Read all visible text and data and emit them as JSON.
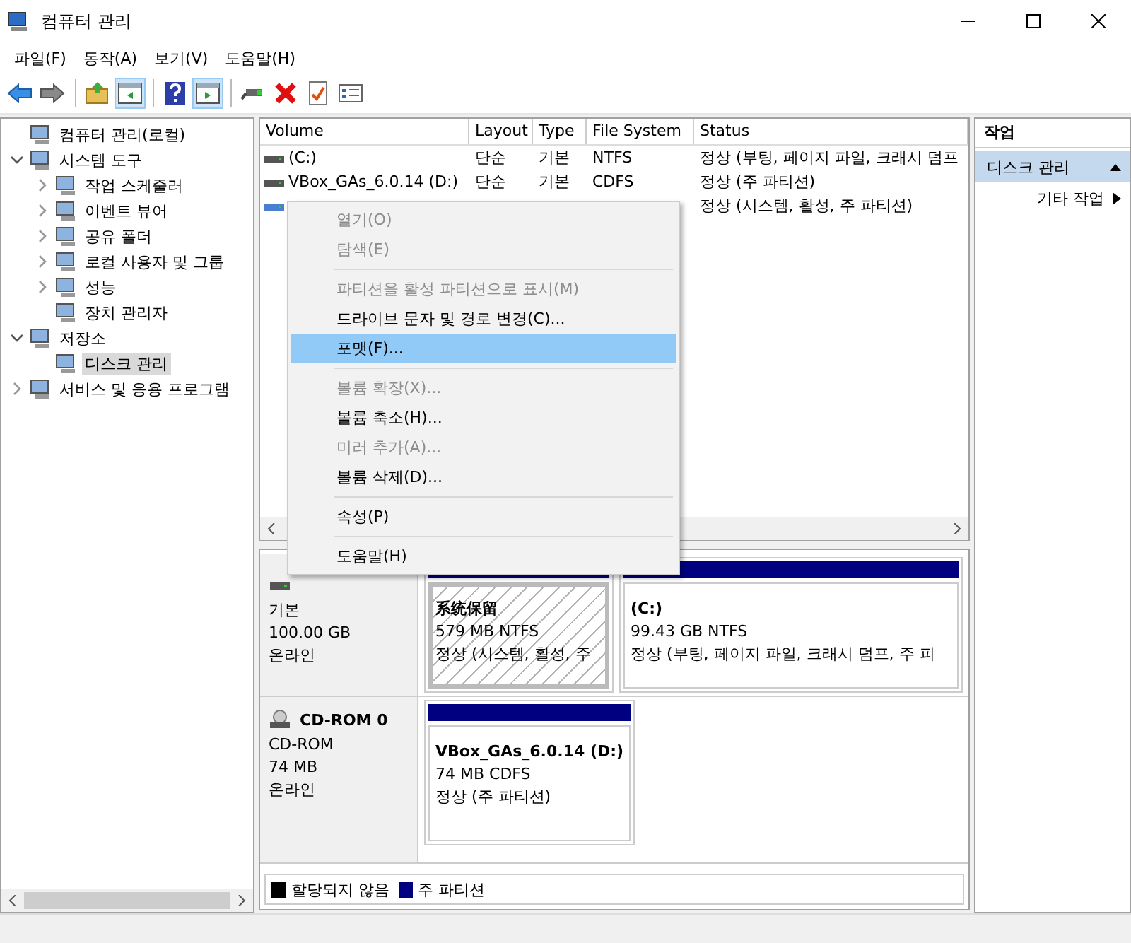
{
  "window": {
    "title": "컴퓨터 관리"
  },
  "menu": [
    "파일(F)",
    "동작(A)",
    "보기(V)",
    "도움말(H)"
  ],
  "toolbar": [
    {
      "kind": "back"
    },
    {
      "kind": "forward"
    },
    {
      "kind": "separator"
    },
    {
      "kind": "up"
    },
    {
      "kind": "tree",
      "pressed": true
    },
    {
      "kind": "separator"
    },
    {
      "kind": "help"
    },
    {
      "kind": "actions",
      "pressed": true
    },
    {
      "kind": "separator"
    },
    {
      "kind": "connect"
    },
    {
      "kind": "delete"
    },
    {
      "kind": "check"
    },
    {
      "kind": "properties"
    }
  ],
  "tree": [
    {
      "label": "컴퓨터 관리(로컬)",
      "selected": false,
      "children": [
        {
          "label": "시스템 도구",
          "expanded": true,
          "selected": false,
          "children": [
            {
              "label": "작업 스케줄러",
              "expanded": false,
              "selected": false
            },
            {
              "label": "이벤트 뷰어",
              "expanded": false,
              "selected": false
            },
            {
              "label": "공유 폴더",
              "expanded": false,
              "selected": false
            },
            {
              "label": "로컬 사용자 및 그룹",
              "expanded": false,
              "selected": false
            },
            {
              "label": "성능",
              "expanded": false,
              "selected": false
            },
            {
              "label": "장치 관리자",
              "selected": false
            }
          ]
        },
        {
          "label": "저장소",
          "expanded": true,
          "selected": false,
          "children": [
            {
              "label": "디스크 관리",
              "selected": true
            }
          ]
        },
        {
          "label": "서비스 및 응용 프로그램",
          "expanded": false,
          "selected": false
        }
      ]
    }
  ],
  "table": {
    "columns": [
      "Volume",
      "Layout",
      "Type",
      "File System",
      "Status"
    ],
    "rows": [
      {
        "volume": "(C:)",
        "layout": "단순",
        "type": "기본",
        "file_system": "NTFS",
        "status": "정상 (부팅, 페이지 파일, 크래시 덤프"
      },
      {
        "volume": "VBox_GAs_6.0.14 (D:)",
        "layout": "단순",
        "type": "기본",
        "file_system": "CDFS",
        "status": "정상 (주 파티션)"
      },
      {
        "status": "정상 (시스템, 활성, 주 파티션)"
      }
    ]
  },
  "disks": [
    {
      "kind": "disk",
      "lines": [
        "기본",
        "100.00 GB",
        "온라인"
      ],
      "partitions": [
        {
          "name": "系统保留",
          "lines": [
            "579 MB NTFS",
            "정상 (시스템, 활성, 주"
          ],
          "selected": true
        },
        {
          "name": "(C:)",
          "lines": [
            "99.43 GB NTFS",
            "정상 (부팅, 페이지 파일, 크래시 덤프, 주 피"
          ],
          "selected": false
        }
      ]
    },
    {
      "kind": "cdrom",
      "name": "CD-ROM 0",
      "lines": [
        "CD-ROM",
        "74 MB",
        "온라인"
      ],
      "partitions": [
        {
          "name": "VBox_GAs_6.0.14  (D:)",
          "lines": [
            "74 MB CDFS",
            "정상 (주 파티션)"
          ],
          "selected": false
        }
      ]
    }
  ],
  "legend": [
    {
      "label": "할당되지 않음",
      "color": "#000000"
    },
    {
      "label": "주 파티션",
      "color": "#000080"
    }
  ],
  "actions": {
    "title": "작업",
    "sections": [
      {
        "label": "디스크 관리",
        "expanded": true,
        "items": [
          "기타 작업"
        ]
      }
    ]
  },
  "context_menu": [
    {
      "kind": "item",
      "label": "열기(O)",
      "disabled": true,
      "selected": false
    },
    {
      "kind": "item",
      "label": "탐색(E)",
      "disabled": true,
      "selected": false
    },
    {
      "kind": "separator"
    },
    {
      "kind": "item",
      "label": "파티션을 활성 파티션으로 표시(M)",
      "disabled": true,
      "selected": false
    },
    {
      "kind": "item",
      "label": "드라이브 문자 및 경로 변경(C)...",
      "disabled": false,
      "selected": false
    },
    {
      "kind": "item",
      "label": "포맷(F)...",
      "disabled": false,
      "selected": true
    },
    {
      "kind": "separator"
    },
    {
      "kind": "item",
      "label": "볼륨 확장(X)...",
      "disabled": true,
      "selected": false
    },
    {
      "kind": "item",
      "label": "볼륨 축소(H)...",
      "disabled": false,
      "selected": false
    },
    {
      "kind": "item",
      "label": "미러 추가(A)...",
      "disabled": true,
      "selected": false
    },
    {
      "kind": "item",
      "label": "볼륨 삭제(D)...",
      "disabled": false,
      "selected": false
    },
    {
      "kind": "separator"
    },
    {
      "kind": "item",
      "label": "속성(P)",
      "disabled": false,
      "selected": false
    },
    {
      "kind": "separator"
    },
    {
      "kind": "item",
      "label": "도움말(H)",
      "disabled": false,
      "selected": false
    }
  ]
}
